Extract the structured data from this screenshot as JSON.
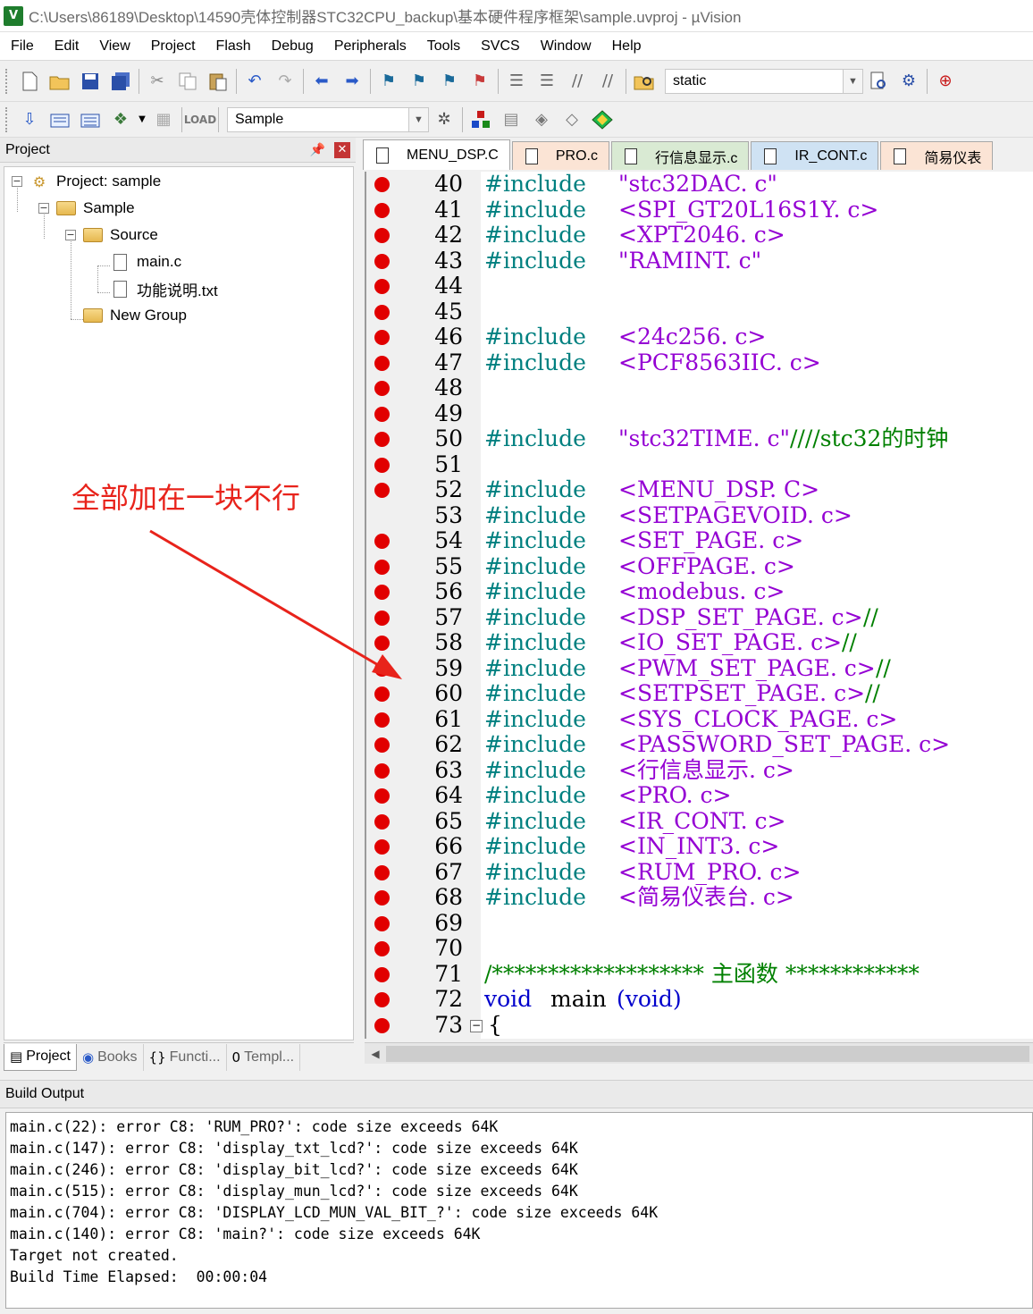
{
  "window": {
    "title": "C:\\Users\\86189\\Desktop\\14590壳体控制器STC32CPU_backup\\基本硬件程序框架\\sample.uvproj - µVision",
    "app_icon": "V"
  },
  "menu": [
    "File",
    "Edit",
    "View",
    "Project",
    "Flash",
    "Debug",
    "Peripherals",
    "Tools",
    "SVCS",
    "Window",
    "Help"
  ],
  "toolbar1": {
    "find_combo_value": "static"
  },
  "toolbar2": {
    "target_combo_value": "Sample"
  },
  "project_panel": {
    "title": "Project",
    "tree": {
      "project": "Project: sample",
      "target": "Sample",
      "group_source": "Source",
      "file_main": "main.c",
      "file_txt": "功能说明.txt",
      "group_new": "New Group"
    },
    "tabs": [
      "Project",
      "Books",
      "Functi...",
      "Templ..."
    ]
  },
  "editor": {
    "tabs": [
      "MENU_DSP.C",
      "PRO.c",
      "行信息显示.c",
      "IR_CONT.c",
      "简易仪表"
    ],
    "lines": [
      {
        "n": "40",
        "bp": true,
        "kw": "#include",
        "path": "\"stc32DAC. c\""
      },
      {
        "n": "41",
        "bp": true,
        "kw": "#include",
        "path": "<SPI_GT20L16S1Y. c>"
      },
      {
        "n": "42",
        "bp": true,
        "kw": "#include",
        "path": "<XPT2046. c>"
      },
      {
        "n": "43",
        "bp": true,
        "kw": "#include",
        "path": "\"RAMINT. c\""
      },
      {
        "n": "44",
        "bp": true
      },
      {
        "n": "45",
        "bp": true
      },
      {
        "n": "46",
        "bp": true,
        "kw": "#include",
        "path": "<24c256. c>"
      },
      {
        "n": "47",
        "bp": true,
        "kw": "#include",
        "path": "<PCF8563IIC. c>"
      },
      {
        "n": "48",
        "bp": true
      },
      {
        "n": "49",
        "bp": true
      },
      {
        "n": "50",
        "bp": true,
        "kw": "#include",
        "path": "\"stc32TIME. c\"",
        "comment": "////stc32的时钟"
      },
      {
        "n": "51",
        "bp": true
      },
      {
        "n": "52",
        "bp": true,
        "kw": "#include",
        "path": "<MENU_DSP. C>"
      },
      {
        "n": "53",
        "bp": false,
        "kw": "#include",
        "path": "<SETPAGEVOID. c>"
      },
      {
        "n": "54",
        "bp": true,
        "kw": "#include",
        "path": "<SET_PAGE. c>"
      },
      {
        "n": "55",
        "bp": true,
        "kw": "#include",
        "path": "<OFFPAGE. c>"
      },
      {
        "n": "56",
        "bp": true,
        "kw": "#include",
        "path": "<modebus. c>"
      },
      {
        "n": "57",
        "bp": true,
        "kw": "#include",
        "path": "<DSP_SET_PAGE. c>",
        "comment": "//"
      },
      {
        "n": "58",
        "bp": true,
        "kw": "#include",
        "path": "<IO_SET_PAGE. c>",
        "comment": "//"
      },
      {
        "n": "59",
        "bp": true,
        "kw": "#include",
        "path": "<PWM_SET_PAGE. c>",
        "comment": "//"
      },
      {
        "n": "60",
        "bp": true,
        "kw": "#include",
        "path": "<SETPSET_PAGE. c>",
        "comment": "//"
      },
      {
        "n": "61",
        "bp": true,
        "kw": "#include",
        "path": "<SYS_CLOCK_PAGE. c>"
      },
      {
        "n": "62",
        "bp": true,
        "kw": "#include",
        "path": "<PASSWORD_SET_PAGE. c>"
      },
      {
        "n": "63",
        "bp": true,
        "kw": "#include",
        "path": "<行信息显示. c>"
      },
      {
        "n": "64",
        "bp": true,
        "kw": "#include",
        "path": "<PRO. c>"
      },
      {
        "n": "65",
        "bp": true,
        "kw": "#include",
        "path": "<IR_CONT. c>"
      },
      {
        "n": "66",
        "bp": true,
        "kw": "#include",
        "path": "<IN_INT3. c>"
      },
      {
        "n": "67",
        "bp": true,
        "kw": "#include",
        "path": "<RUM_PRO. c>"
      },
      {
        "n": "68",
        "bp": true,
        "kw": "#include",
        "path": "<简易仪表台. c>"
      },
      {
        "n": "69",
        "bp": true
      },
      {
        "n": "70",
        "bp": true
      },
      {
        "n": "71",
        "bp": true,
        "comment": "/******************* 主函数 ************"
      },
      {
        "n": "72",
        "bp": true,
        "kw2": "void",
        "plain": "main",
        "kw3": "(void)"
      },
      {
        "n": "73",
        "bp": true,
        "plain": "{"
      }
    ]
  },
  "build_output": {
    "title": "Build Output",
    "lines": [
      "main.c(22): error C8: 'RUM_PRO?': code size exceeds 64K",
      "main.c(147): error C8: 'display_txt_lcd?': code size exceeds 64K",
      "main.c(246): error C8: 'display_bit_lcd?': code size exceeds 64K",
      "main.c(515): error C8: 'display_mun_lcd?': code size exceeds 64K",
      "main.c(704): error C8: 'DISPLAY_LCD_MUN_VAL_BIT_?': code size exceeds 64K",
      "main.c(140): error C8: 'main?': code size exceeds 64K",
      "Target not created.",
      "Build Time Elapsed:  00:00:04"
    ]
  },
  "annotation": {
    "text": "全部加在一块不行",
    "color": "#e8231b"
  },
  "colors": {
    "breakpoint": "#e10000",
    "include_keyword": "#008080",
    "include_path": "#9400d3",
    "comment": "#008000",
    "keyword": "#0000cc"
  }
}
